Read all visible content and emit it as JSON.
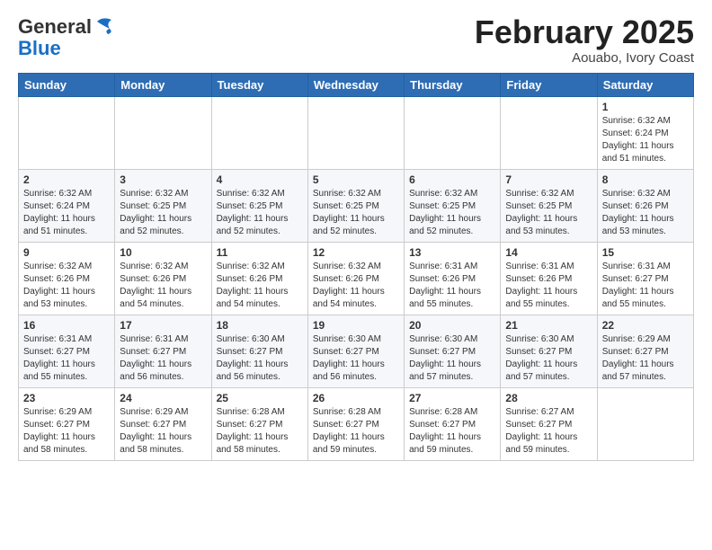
{
  "header": {
    "logo_general": "General",
    "logo_blue": "Blue",
    "month_title": "February 2025",
    "location": "Aouabo, Ivory Coast"
  },
  "days_of_week": [
    "Sunday",
    "Monday",
    "Tuesday",
    "Wednesday",
    "Thursday",
    "Friday",
    "Saturday"
  ],
  "weeks": [
    [
      {
        "day": "",
        "info": ""
      },
      {
        "day": "",
        "info": ""
      },
      {
        "day": "",
        "info": ""
      },
      {
        "day": "",
        "info": ""
      },
      {
        "day": "",
        "info": ""
      },
      {
        "day": "",
        "info": ""
      },
      {
        "day": "1",
        "info": "Sunrise: 6:32 AM\nSunset: 6:24 PM\nDaylight: 11 hours and 51 minutes."
      }
    ],
    [
      {
        "day": "2",
        "info": "Sunrise: 6:32 AM\nSunset: 6:24 PM\nDaylight: 11 hours and 51 minutes."
      },
      {
        "day": "3",
        "info": "Sunrise: 6:32 AM\nSunset: 6:25 PM\nDaylight: 11 hours and 52 minutes."
      },
      {
        "day": "4",
        "info": "Sunrise: 6:32 AM\nSunset: 6:25 PM\nDaylight: 11 hours and 52 minutes."
      },
      {
        "day": "5",
        "info": "Sunrise: 6:32 AM\nSunset: 6:25 PM\nDaylight: 11 hours and 52 minutes."
      },
      {
        "day": "6",
        "info": "Sunrise: 6:32 AM\nSunset: 6:25 PM\nDaylight: 11 hours and 52 minutes."
      },
      {
        "day": "7",
        "info": "Sunrise: 6:32 AM\nSunset: 6:25 PM\nDaylight: 11 hours and 53 minutes."
      },
      {
        "day": "8",
        "info": "Sunrise: 6:32 AM\nSunset: 6:26 PM\nDaylight: 11 hours and 53 minutes."
      }
    ],
    [
      {
        "day": "9",
        "info": "Sunrise: 6:32 AM\nSunset: 6:26 PM\nDaylight: 11 hours and 53 minutes."
      },
      {
        "day": "10",
        "info": "Sunrise: 6:32 AM\nSunset: 6:26 PM\nDaylight: 11 hours and 54 minutes."
      },
      {
        "day": "11",
        "info": "Sunrise: 6:32 AM\nSunset: 6:26 PM\nDaylight: 11 hours and 54 minutes."
      },
      {
        "day": "12",
        "info": "Sunrise: 6:32 AM\nSunset: 6:26 PM\nDaylight: 11 hours and 54 minutes."
      },
      {
        "day": "13",
        "info": "Sunrise: 6:31 AM\nSunset: 6:26 PM\nDaylight: 11 hours and 55 minutes."
      },
      {
        "day": "14",
        "info": "Sunrise: 6:31 AM\nSunset: 6:26 PM\nDaylight: 11 hours and 55 minutes."
      },
      {
        "day": "15",
        "info": "Sunrise: 6:31 AM\nSunset: 6:27 PM\nDaylight: 11 hours and 55 minutes."
      }
    ],
    [
      {
        "day": "16",
        "info": "Sunrise: 6:31 AM\nSunset: 6:27 PM\nDaylight: 11 hours and 55 minutes."
      },
      {
        "day": "17",
        "info": "Sunrise: 6:31 AM\nSunset: 6:27 PM\nDaylight: 11 hours and 56 minutes."
      },
      {
        "day": "18",
        "info": "Sunrise: 6:30 AM\nSunset: 6:27 PM\nDaylight: 11 hours and 56 minutes."
      },
      {
        "day": "19",
        "info": "Sunrise: 6:30 AM\nSunset: 6:27 PM\nDaylight: 11 hours and 56 minutes."
      },
      {
        "day": "20",
        "info": "Sunrise: 6:30 AM\nSunset: 6:27 PM\nDaylight: 11 hours and 57 minutes."
      },
      {
        "day": "21",
        "info": "Sunrise: 6:30 AM\nSunset: 6:27 PM\nDaylight: 11 hours and 57 minutes."
      },
      {
        "day": "22",
        "info": "Sunrise: 6:29 AM\nSunset: 6:27 PM\nDaylight: 11 hours and 57 minutes."
      }
    ],
    [
      {
        "day": "23",
        "info": "Sunrise: 6:29 AM\nSunset: 6:27 PM\nDaylight: 11 hours and 58 minutes."
      },
      {
        "day": "24",
        "info": "Sunrise: 6:29 AM\nSunset: 6:27 PM\nDaylight: 11 hours and 58 minutes."
      },
      {
        "day": "25",
        "info": "Sunrise: 6:28 AM\nSunset: 6:27 PM\nDaylight: 11 hours and 58 minutes."
      },
      {
        "day": "26",
        "info": "Sunrise: 6:28 AM\nSunset: 6:27 PM\nDaylight: 11 hours and 59 minutes."
      },
      {
        "day": "27",
        "info": "Sunrise: 6:28 AM\nSunset: 6:27 PM\nDaylight: 11 hours and 59 minutes."
      },
      {
        "day": "28",
        "info": "Sunrise: 6:27 AM\nSunset: 6:27 PM\nDaylight: 11 hours and 59 minutes."
      },
      {
        "day": "",
        "info": ""
      }
    ]
  ]
}
